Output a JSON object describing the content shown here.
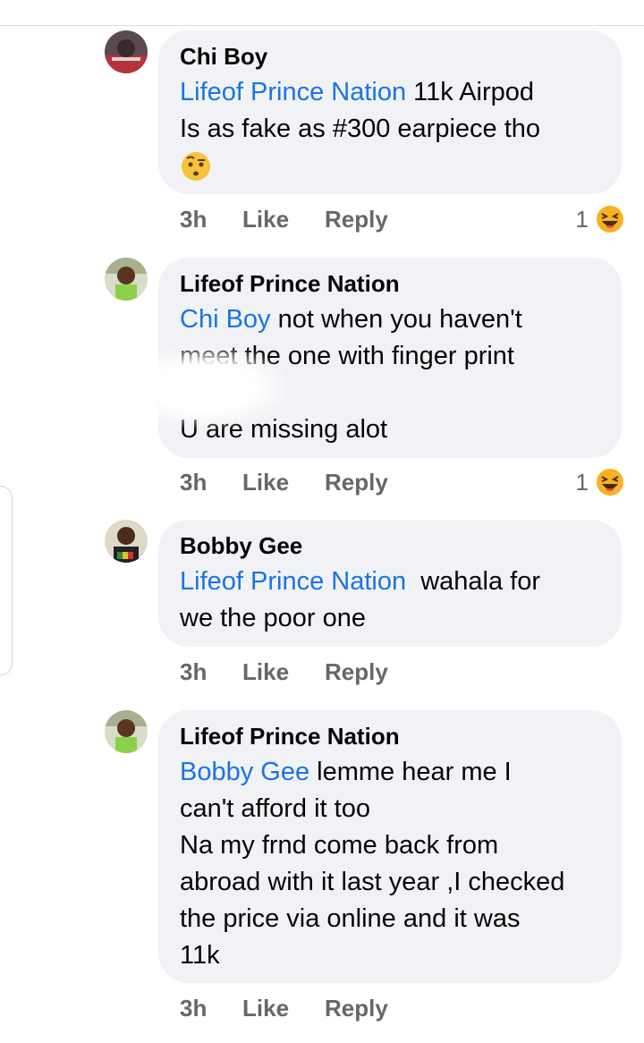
{
  "comments": [
    {
      "author": "Chi Boy",
      "mention": "Lifeof Prince Nation",
      "text_lines": [
        " 11k Airpod",
        "Is as fake as #300 earpiece tho"
      ],
      "emoji": "raised-eyebrow-emoji",
      "time": "3h",
      "like_label": "Like",
      "reply_label": "Reply",
      "reaction_count": "1",
      "reaction_icon": "laughing-emoji"
    },
    {
      "author": "Lifeof Prince Nation",
      "mention": "Chi Boy",
      "text_lines": [
        " not when you haven't",
        "meet the one with finger print",
        "",
        "U are missing alot"
      ],
      "time": "3h",
      "like_label": "Like",
      "reply_label": "Reply",
      "reaction_count": "1",
      "reaction_icon": "laughing-emoji"
    },
    {
      "author": "Bobby Gee",
      "mention": "Lifeof Prince Nation",
      "text_lines": [
        "  wahala for",
        "we the poor one"
      ],
      "time": "3h",
      "like_label": "Like",
      "reply_label": "Reply"
    },
    {
      "author": "Lifeof Prince Nation",
      "mention": "Bobby Gee",
      "text_lines": [
        " lemme hear me I",
        "can't afford it too",
        "Na my frnd come back from",
        "abroad with it last year ,I checked",
        "the price via online and it was",
        "11k"
      ],
      "time": "3h",
      "like_label": "Like",
      "reply_label": "Reply"
    }
  ],
  "colors": {
    "bubble": "#f0f2f5",
    "mention": "#1b74e4",
    "meta": "#65676b",
    "reaction": "#f7b125"
  }
}
